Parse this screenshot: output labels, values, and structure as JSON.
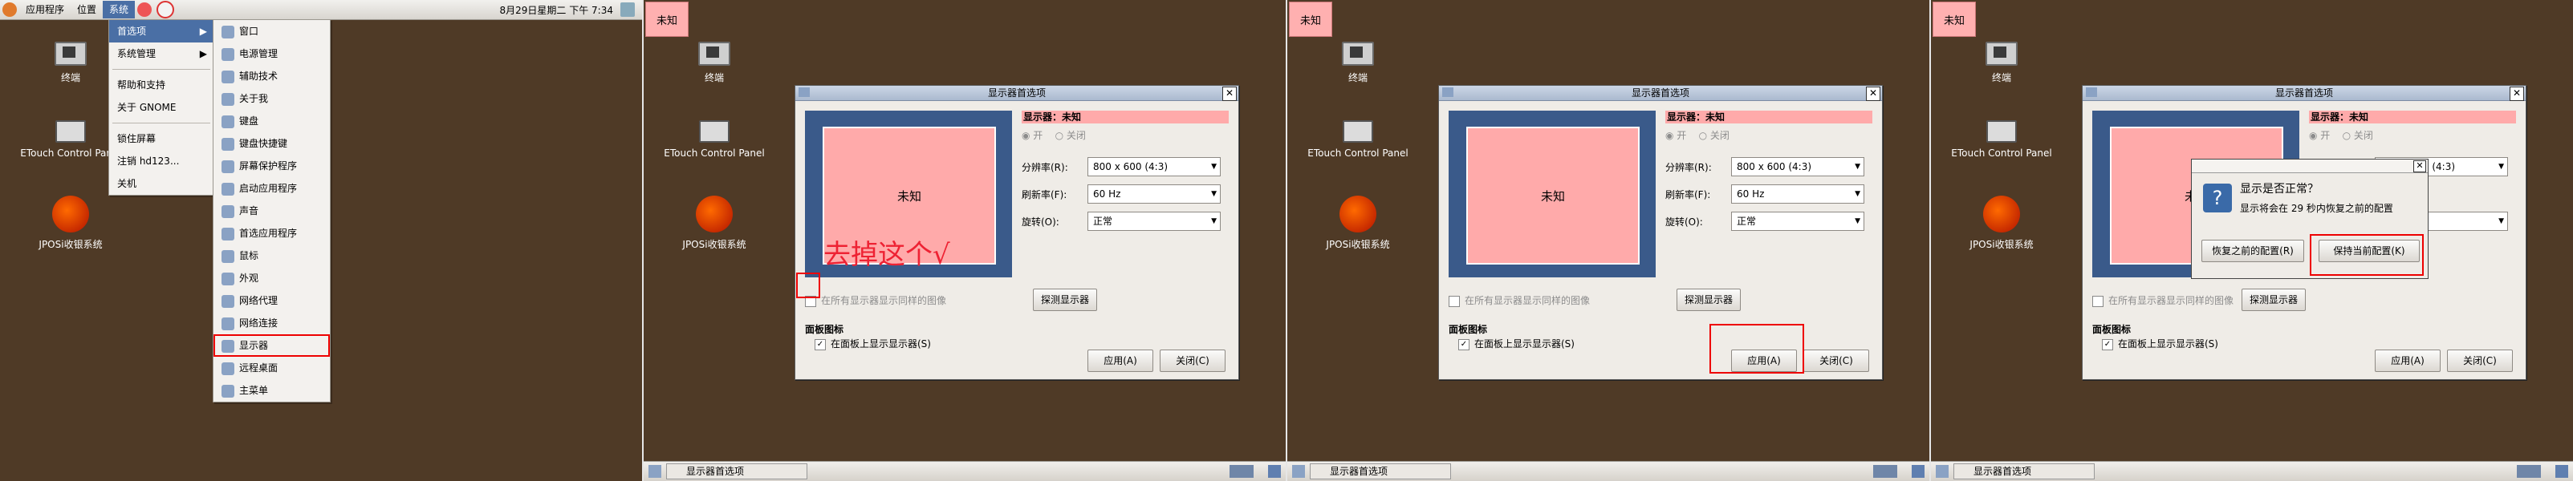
{
  "topbar": {
    "applications": "应用程序",
    "places": "位置",
    "system": "系统",
    "clock": "8月29日星期二 下午 7:34"
  },
  "desktop": {
    "terminal": "终端",
    "etouch": "ETouch Control Panel",
    "jposi": "JPOSi收银系统"
  },
  "tag": "未知",
  "menus": {
    "system": [
      "首选项",
      "系统管理",
      "帮助和支持",
      "关于 GNOME",
      "锁住屏幕",
      "注销 hd123...",
      "关机"
    ],
    "prefs": [
      "窗口",
      "电源管理",
      "辅助技术",
      "关于我",
      "键盘",
      "键盘快捷键",
      "屏幕保护程序",
      "启动应用程序",
      "声音",
      "首选应用程序",
      "鼠标",
      "外观",
      "网络代理",
      "网络连接",
      "显示器",
      "远程桌面",
      "主菜单"
    ]
  },
  "dialog": {
    "title": "显示器首选项",
    "preview_label": "未知",
    "monitor_label": "显示器：未知",
    "radio_on": "开",
    "radio_off": "关闭",
    "resolution_label": "分辨率(R):",
    "resolution_value": "800 x 600 (4:3)",
    "refresh_label": "刷新率(F):",
    "refresh_value": "60 Hz",
    "rotation_label": "旋转(O):",
    "rotation_value": "正常",
    "mirror_label": "在所有显示器显示同样的图像",
    "detect_btn": "探测显示器",
    "panel_icon_header": "面板图标",
    "panel_icon_label": "在面板上显示显示器(S)",
    "apply_btn": "应用(A)",
    "close_btn": "关闭(C)"
  },
  "annotation": "去掉这个√",
  "confirm": {
    "title": "显示是否正常？",
    "message": "显示将会在 29 秒内恢复之前的配置",
    "revert_btn": "恢复之前的配置(R)",
    "keep_btn": "保持当前配置(K)"
  },
  "taskbar": {
    "task": "显示器首选项"
  }
}
